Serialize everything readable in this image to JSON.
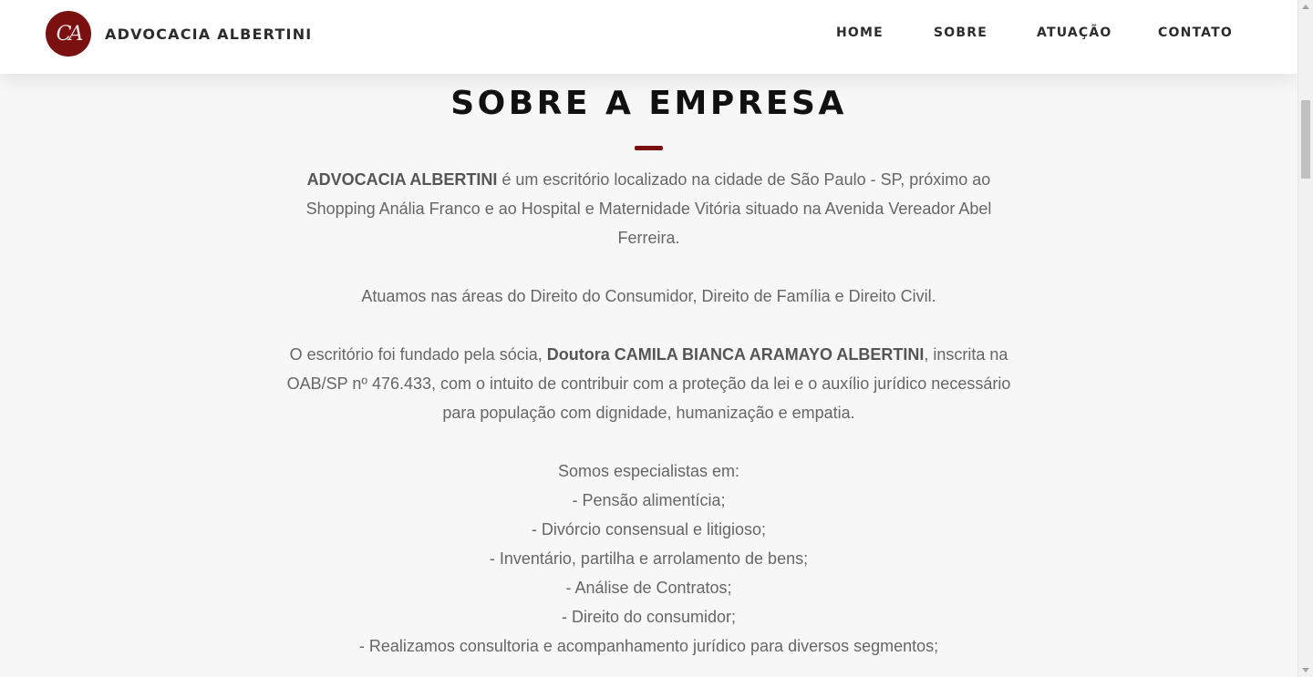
{
  "brand": {
    "logo_text": "CA",
    "name": "ADVOCACIA ALBERTINI",
    "logo_color": "#7a1010"
  },
  "nav": {
    "items": [
      {
        "label": "HOME"
      },
      {
        "label": "SOBRE"
      },
      {
        "label": "ATUAÇÃO"
      },
      {
        "label": "CONTATO"
      }
    ]
  },
  "section": {
    "title": "SOBRE A EMPRESA",
    "paragraph1": {
      "bold_company": "ADVOCACIA ALBERTINI",
      "text_after": " é um escritório localizado na cidade de São Paulo - SP, próximo ao Shopping Anália Franco e ao Hospital e Maternidade Vitória situado na Avenida Vereador Abel Ferreira."
    },
    "paragraph2": "Atuamos nas áreas do Direito do Consumidor, Direito de Família e Direito Civil.",
    "paragraph3": {
      "text_before": "O escritório foi fundado pela sócia, ",
      "bold_name": "Doutora CAMILA BIANCA ARAMAYO ALBERTINI",
      "text_after": ", inscrita na OAB/SP nº 476.433, com o intuito de contribuir com a proteção da lei e o auxílio jurídico necessário para população com dignidade, humanização e empatia."
    },
    "specialties_heading": "Somos especialistas em:",
    "specialties": [
      "- Pensão alimentícia;",
      "- Divórcio consensual e litigioso;",
      "- Inventário, partilha e arrolamento de bens;",
      "- Análise de Contratos;",
      "- Direito do consumidor;",
      "- Realizamos consultoria e acompanhamento jurídico para diversos segmentos;"
    ]
  }
}
